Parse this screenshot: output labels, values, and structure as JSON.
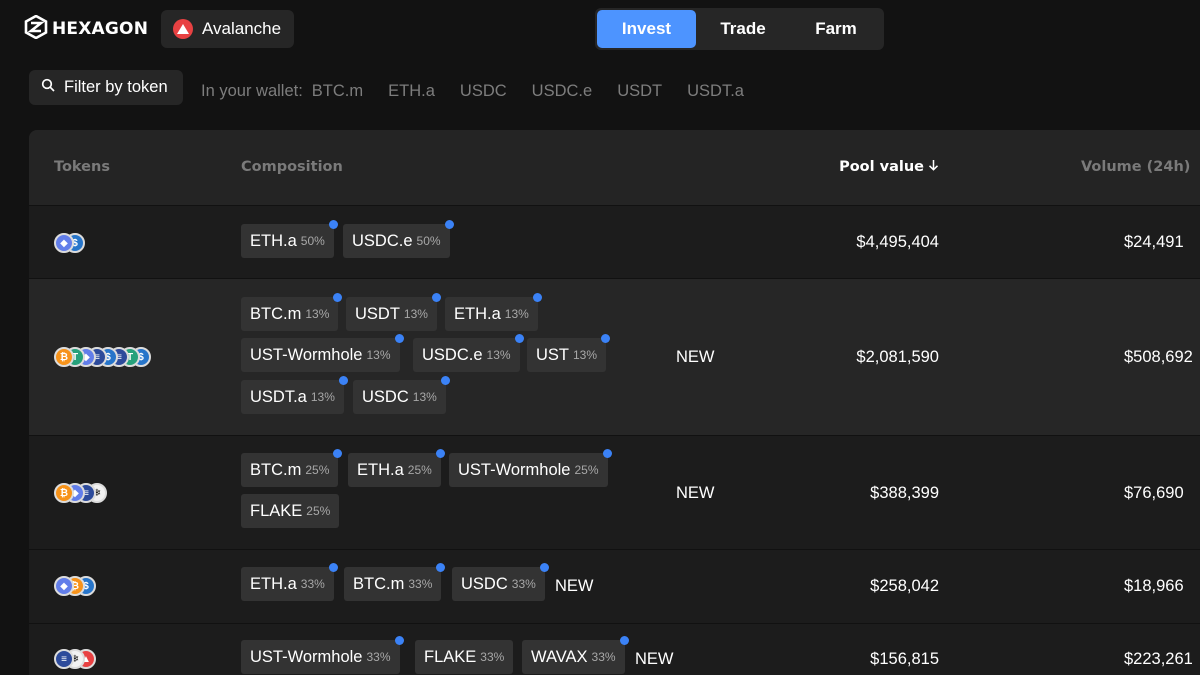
{
  "app": {
    "logo_text": "HEXAGON"
  },
  "network": {
    "label": "Avalanche",
    "icon": "avalanche-icon",
    "color": "#e84142"
  },
  "nav": {
    "tabs": [
      {
        "label": "Invest",
        "active": true
      },
      {
        "label": "Trade",
        "active": false
      },
      {
        "label": "Farm",
        "active": false
      }
    ]
  },
  "filter": {
    "label": "Filter by token",
    "icon": "search-icon"
  },
  "wallet": {
    "label": "In your wallet:",
    "tokens": [
      "BTC.m",
      "ETH.a",
      "USDC",
      "USDC.e",
      "USDT",
      "USDT.a"
    ]
  },
  "table": {
    "headers": {
      "tokens": "Tokens",
      "composition": "Composition",
      "pool_value": "Pool value",
      "volume": "Volume (24h)"
    },
    "sort_icon": "arrow-down-icon",
    "rows": [
      {
        "tokens": [
          "eth",
          "usdc"
        ],
        "chips": [
          {
            "name": "ETH.a",
            "pct": "50%"
          },
          {
            "name": "USDC.e",
            "pct": "50%"
          }
        ],
        "is_new": false,
        "new_label": "",
        "pool_value": "$4,495,404",
        "volume": "$24,491"
      },
      {
        "tokens": [
          "btc",
          "usdt",
          "eth",
          "ust",
          "usdc",
          "ust",
          "usdt",
          "usdc"
        ],
        "chips": [
          {
            "name": "BTC.m",
            "pct": "13%"
          },
          {
            "name": "USDT",
            "pct": "13%"
          },
          {
            "name": "ETH.a",
            "pct": "13%"
          },
          {
            "name": "UST-Wormhole",
            "pct": "13%"
          },
          {
            "name": "USDC.e",
            "pct": "13%"
          },
          {
            "name": "UST",
            "pct": "13%"
          },
          {
            "name": "USDT.a",
            "pct": "13%"
          },
          {
            "name": "USDC",
            "pct": "13%"
          }
        ],
        "is_new": true,
        "new_label": "NEW",
        "pool_value": "$2,081,590",
        "volume": "$508,692"
      },
      {
        "tokens": [
          "btc",
          "eth",
          "ust",
          "flake"
        ],
        "chips": [
          {
            "name": "BTC.m",
            "pct": "25%"
          },
          {
            "name": "ETH.a",
            "pct": "25%"
          },
          {
            "name": "UST-Wormhole",
            "pct": "25%"
          },
          {
            "name": "FLAKE",
            "pct": "25%"
          }
        ],
        "is_new": true,
        "new_label": "NEW",
        "pool_value": "$388,399",
        "volume": "$76,690"
      },
      {
        "tokens": [
          "eth",
          "btc",
          "usdc"
        ],
        "chips": [
          {
            "name": "ETH.a",
            "pct": "33%"
          },
          {
            "name": "BTC.m",
            "pct": "33%"
          },
          {
            "name": "USDC",
            "pct": "33%"
          }
        ],
        "is_new": true,
        "new_label": "NEW",
        "pool_value": "$258,042",
        "volume": "$18,966"
      },
      {
        "tokens": [
          "ust",
          "flake",
          "avax"
        ],
        "chips": [
          {
            "name": "UST-Wormhole",
            "pct": "33%"
          },
          {
            "name": "FLAKE",
            "pct": "33%"
          },
          {
            "name": "WAVAX",
            "pct": "33%"
          }
        ],
        "is_new": true,
        "new_label": "NEW",
        "pool_value": "$156,815",
        "volume": "$223,261"
      }
    ]
  },
  "colors": {
    "accent": "#4d94ff",
    "chip_dot": "#3b82f6",
    "background": "#121212",
    "token_btc": "#f7931a",
    "token_eth": "#627eea",
    "token_usdc": "#2775ca",
    "token_usdt": "#26a17b",
    "token_ust": "#2d4b9b",
    "token_flake": "#f2f2f2",
    "token_avax": "#e84142"
  }
}
